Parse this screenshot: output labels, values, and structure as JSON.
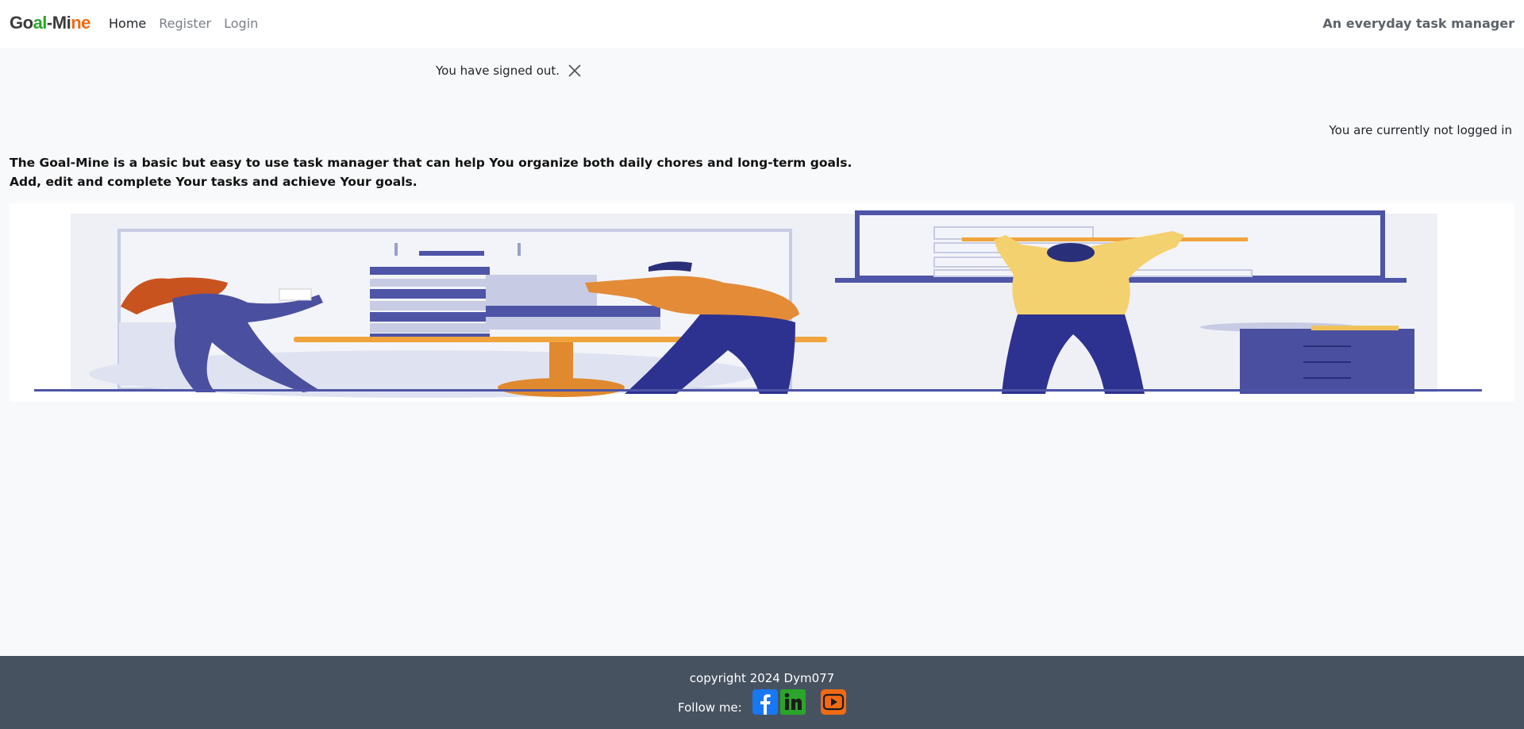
{
  "brand": {
    "letters": [
      {
        "t": "Go",
        "color": "#3a3a3a"
      },
      {
        "t": "al",
        "color": "#2aa52a"
      },
      {
        "t": "-",
        "color": "#3a3a3a"
      },
      {
        "t": "Mi",
        "color": "#3a3a3a"
      },
      {
        "t": "ne",
        "color": "#f26a14"
      }
    ]
  },
  "nav": {
    "home": "Home",
    "register": "Register",
    "login": "Login"
  },
  "tagline": "An everyday task manager",
  "alert": {
    "message": "You have signed out."
  },
  "status": "You are currently not logged in",
  "intro": {
    "line1": "The Goal-Mine is a basic but easy to use task manager that can help You organize both daily chores and long-term goals.",
    "line2": "Add, edit and complete Your tasks and achieve Your goals."
  },
  "footer": {
    "copyright": "copyright 2024 Dym077",
    "follow": "Follow me:",
    "social": [
      {
        "name": "facebook-icon",
        "color": "#1877f2"
      },
      {
        "name": "linkedin-icon",
        "color": "#2aa52a"
      },
      {
        "name": "youtube-icon",
        "color": "#f26a14"
      }
    ]
  }
}
